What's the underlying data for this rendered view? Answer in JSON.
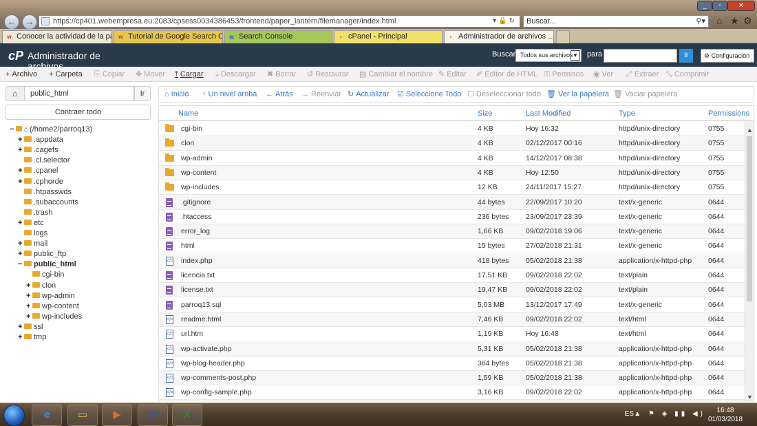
{
  "browser": {
    "url": "https://cp401.webempresa.eu:2083/cpsess0034386453/frontend/paper_lantern/filemanager/index.html",
    "search_placeholder": "Buscar...",
    "tabs": [
      {
        "label": "Conocer la actividad de la pági...",
        "bg": "#efe8d8",
        "icon_color": "#c0392b",
        "icon": "w"
      },
      {
        "label": "Tutorial de Google Search Con...",
        "bg": "#e6c74d",
        "icon_color": "#c0392b",
        "icon": "w"
      },
      {
        "label": "Search Console",
        "bg": "#a6c85a",
        "icon_color": "#3a7bd5",
        "icon": "▣"
      },
      {
        "label": "cPanel - Principal",
        "bg": "#f0e16b",
        "icon_color": "#e67e22",
        "icon": "◐"
      },
      {
        "label": "Administrador de archivos ...",
        "bg": "#f7f3e8",
        "icon_color": "#e67e22",
        "icon": "◐"
      }
    ]
  },
  "header": {
    "logo": "cP",
    "title": "Administrador de archivos",
    "search_label": "Buscar",
    "search_scope": "Todos sus archivos",
    "para_label": "para",
    "go_label": "Ir",
    "config_label": "Configuración"
  },
  "toolbar": [
    {
      "icon": "+",
      "label": "Archivo",
      "state": "enabled"
    },
    {
      "icon": "+",
      "label": "Carpeta",
      "state": "enabled"
    },
    {
      "icon": "⎘",
      "label": "Copiar",
      "state": "disabled"
    },
    {
      "icon": "✥",
      "label": "Mover",
      "state": "disabled"
    },
    {
      "icon": "⤒",
      "label": "Cargar",
      "state": "active"
    },
    {
      "icon": "⤓",
      "label": "Descargar",
      "state": "disabled"
    },
    {
      "icon": "✖",
      "label": "Borrar",
      "state": "disabled"
    },
    {
      "icon": "↺",
      "label": "Restaurar",
      "state": "disabled"
    },
    {
      "icon": "▤",
      "label": "Cambiar el nombre",
      "state": "disabled"
    },
    {
      "icon": "✎",
      "label": "Editar",
      "state": "disabled"
    },
    {
      "icon": "✐",
      "label": "Editor de HTML",
      "state": "disabled"
    },
    {
      "icon": "⚿",
      "label": "Permisos",
      "state": "disabled"
    },
    {
      "icon": "◉",
      "label": "Ver",
      "state": "disabled"
    },
    {
      "icon": "⤢",
      "label": "Extraer",
      "state": "disabled"
    },
    {
      "icon": "⤡",
      "label": "Comprimir",
      "state": "disabled"
    }
  ],
  "sidebar": {
    "path_value": "public_html",
    "go_label": "Ir",
    "collapse_label": "Contraer todo",
    "tree": [
      {
        "label": "(/home2/parroq13)",
        "exp": "−",
        "type": "home",
        "level": 0
      },
      {
        "label": ".appdata",
        "exp": "+",
        "type": "folder",
        "level": 1
      },
      {
        "label": ".cagefs",
        "exp": "+",
        "type": "folder",
        "level": 1
      },
      {
        "label": ".cl.selector",
        "exp": "",
        "type": "folder",
        "level": 1
      },
      {
        "label": ".cpanel",
        "exp": "+",
        "type": "folder",
        "level": 1
      },
      {
        "label": ".cphorde",
        "exp": "+",
        "type": "folder",
        "level": 1
      },
      {
        "label": ".htpasswds",
        "exp": "",
        "type": "folder",
        "level": 1
      },
      {
        "label": ".subaccounts",
        "exp": "",
        "type": "folder",
        "level": 1
      },
      {
        "label": ".trash",
        "exp": "",
        "type": "folder",
        "level": 1
      },
      {
        "label": "etc",
        "exp": "+",
        "type": "folder",
        "level": 1
      },
      {
        "label": "logs",
        "exp": "",
        "type": "folder",
        "level": 1
      },
      {
        "label": "mail",
        "exp": "+",
        "type": "folder",
        "level": 1
      },
      {
        "label": "public_ftp",
        "exp": "+",
        "type": "folder",
        "level": 1
      },
      {
        "label": "public_html",
        "exp": "−",
        "type": "folder",
        "level": 1,
        "bold": true
      },
      {
        "label": "cgi-bin",
        "exp": "",
        "type": "folder",
        "level": 2
      },
      {
        "label": "clon",
        "exp": "+",
        "type": "folder",
        "level": 2
      },
      {
        "label": "wp-admin",
        "exp": "+",
        "type": "folder",
        "level": 2
      },
      {
        "label": "wp-content",
        "exp": "+",
        "type": "folder",
        "level": 2
      },
      {
        "label": "wp-includes",
        "exp": "+",
        "type": "folder",
        "level": 2
      },
      {
        "label": "ssl",
        "exp": "+",
        "type": "folder",
        "level": 1
      },
      {
        "label": "tmp",
        "exp": "+",
        "type": "folder",
        "level": 1
      }
    ]
  },
  "actions": [
    {
      "icon": "⌂",
      "label": "Inicio",
      "state": "enabled"
    },
    {
      "icon": "↑",
      "label": "Un nivel arriba",
      "state": "enabled"
    },
    {
      "icon": "←",
      "label": "Atrás",
      "state": "enabled"
    },
    {
      "icon": "→",
      "label": "Reenviar",
      "state": "disabled"
    },
    {
      "icon": "↻",
      "label": "Actualizar",
      "state": "enabled"
    },
    {
      "icon": "☑",
      "label": "Seleccione Todo",
      "state": "enabled"
    },
    {
      "icon": "☐",
      "label": "Deseleccionar todo",
      "state": "disabled"
    },
    {
      "icon": "🗑",
      "label": "Ver la papelera",
      "state": "enabled"
    },
    {
      "icon": "🗑",
      "label": "Vaciar papelera",
      "state": "disabled"
    }
  ],
  "table": {
    "columns": [
      "Name",
      "Size",
      "Last Modified",
      "Type",
      "Permissions"
    ],
    "rows": [
      {
        "icon": "folder",
        "name": "cgi-bin",
        "size": "4 KB",
        "modified": "Hoy 16:32",
        "type": "httpd/unix-directory",
        "perms": "0755"
      },
      {
        "icon": "folder",
        "name": "clon",
        "size": "4 KB",
        "modified": "02/12/2017 00:16",
        "type": "httpd/unix-directory",
        "perms": "0755"
      },
      {
        "icon": "folder",
        "name": "wp-admin",
        "size": "4 KB",
        "modified": "14/12/2017 08:38",
        "type": "httpd/unix-directory",
        "perms": "0755"
      },
      {
        "icon": "folder",
        "name": "wp-content",
        "size": "4 KB",
        "modified": "Hoy 12:50",
        "type": "httpd/unix-directory",
        "perms": "0755"
      },
      {
        "icon": "folder",
        "name": "wp-includes",
        "size": "12 KB",
        "modified": "24/11/2017 15:27",
        "type": "httpd/unix-directory",
        "perms": "0755"
      },
      {
        "icon": "text",
        "name": ".gitignore",
        "size": "44 bytes",
        "modified": "22/09/2017 10:20",
        "type": "text/x-generic",
        "perms": "0644"
      },
      {
        "icon": "text",
        "name": ".htaccess",
        "size": "236 bytes",
        "modified": "23/09/2017 23:39",
        "type": "text/x-generic",
        "perms": "0644"
      },
      {
        "icon": "text",
        "name": "error_log",
        "size": "1,66 KB",
        "modified": "09/02/2018 19:06",
        "type": "text/x-generic",
        "perms": "0644"
      },
      {
        "icon": "text",
        "name": "html",
        "size": "15 bytes",
        "modified": "27/02/2018 21:31",
        "type": "text/x-generic",
        "perms": "0644"
      },
      {
        "icon": "code",
        "name": "index.php",
        "size": "418 bytes",
        "modified": "05/02/2018 21:38",
        "type": "application/x-httpd-php",
        "perms": "0644"
      },
      {
        "icon": "text",
        "name": "licencia.txt",
        "size": "17,51 KB",
        "modified": "09/02/2018 22:02",
        "type": "text/plain",
        "perms": "0644"
      },
      {
        "icon": "text",
        "name": "license.txt",
        "size": "19,47 KB",
        "modified": "09/02/2018 22:02",
        "type": "text/plain",
        "perms": "0644"
      },
      {
        "icon": "text",
        "name": "parroq13.sql",
        "size": "5,03 MB",
        "modified": "13/12/2017 17:49",
        "type": "text/x-generic",
        "perms": "0644"
      },
      {
        "icon": "code",
        "name": "readme.html",
        "size": "7,46 KB",
        "modified": "09/02/2018 22:02",
        "type": "text/html",
        "perms": "0644"
      },
      {
        "icon": "code",
        "name": "url.htm",
        "size": "1,19 KB",
        "modified": "Hoy 16:48",
        "type": "text/html",
        "perms": "0644"
      },
      {
        "icon": "code",
        "name": "wp-activate.php",
        "size": "5,31 KB",
        "modified": "05/02/2018 21:38",
        "type": "application/x-httpd-php",
        "perms": "0644"
      },
      {
        "icon": "code",
        "name": "wp-blog-header.php",
        "size": "364 bytes",
        "modified": "05/02/2018 21:38",
        "type": "application/x-httpd-php",
        "perms": "0644"
      },
      {
        "icon": "code",
        "name": "wp-comments-post.php",
        "size": "1,59 KB",
        "modified": "05/02/2018 21:38",
        "type": "application/x-httpd-php",
        "perms": "0644"
      },
      {
        "icon": "code",
        "name": "wp-config-sample.php",
        "size": "3,16 KB",
        "modified": "09/02/2018 22:02",
        "type": "application/x-httpd-php",
        "perms": "0644"
      }
    ]
  },
  "taskbar": {
    "apps": [
      {
        "name": "internet-explorer",
        "glyph": "e"
      },
      {
        "name": "file-explorer",
        "glyph": "▭"
      },
      {
        "name": "media-player",
        "glyph": "▶"
      },
      {
        "name": "word",
        "glyph": "W"
      },
      {
        "name": "excel",
        "glyph": "X"
      }
    ],
    "lang": "ES",
    "time": "16:48",
    "date": "01/03/2018"
  },
  "colors": {
    "accent": "#3378c8",
    "header_bg": "#293a4a",
    "folder": "#e8a931",
    "text_file": "#8a5fb5"
  }
}
